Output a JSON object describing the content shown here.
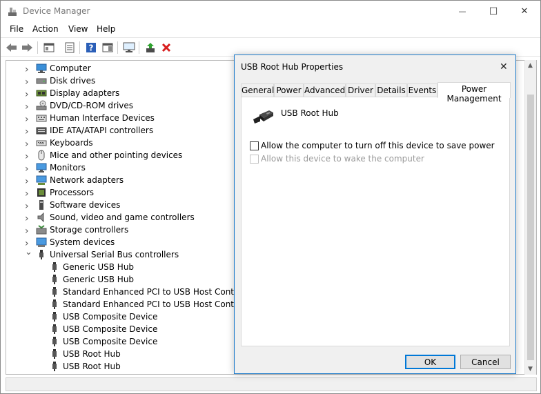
{
  "window": {
    "title": "Device Manager",
    "minimize_glyph": "—",
    "maximize_glyph": "☐",
    "close_glyph": "✕"
  },
  "menu": [
    {
      "label": "File"
    },
    {
      "label": "Action"
    },
    {
      "label": "View"
    },
    {
      "label": "Help"
    }
  ],
  "toolbar": {
    "buttons": [
      "back-icon",
      "forward-icon",
      "show-hide-tree-icon",
      "properties-icon",
      "help-icon",
      "action-pane-icon",
      "monitor-icon",
      "update-driver-icon",
      "uninstall-icon"
    ]
  },
  "tree": {
    "items": [
      {
        "label": "Computer",
        "icon": "computer-icon",
        "state": "collapsed"
      },
      {
        "label": "Disk drives",
        "icon": "disk-drive-icon",
        "state": "collapsed"
      },
      {
        "label": "Display adapters",
        "icon": "display-adapter-icon",
        "state": "collapsed"
      },
      {
        "label": "DVD/CD-ROM drives",
        "icon": "dvd-icon",
        "state": "collapsed"
      },
      {
        "label": "Human Interface Devices",
        "icon": "hid-icon",
        "state": "collapsed"
      },
      {
        "label": "IDE ATA/ATAPI controllers",
        "icon": "ide-icon",
        "state": "collapsed"
      },
      {
        "label": "Keyboards",
        "icon": "keyboard-icon",
        "state": "collapsed"
      },
      {
        "label": "Mice and other pointing devices",
        "icon": "mouse-icon",
        "state": "collapsed"
      },
      {
        "label": "Monitors",
        "icon": "monitor-icon",
        "state": "collapsed"
      },
      {
        "label": "Network adapters",
        "icon": "network-icon",
        "state": "collapsed"
      },
      {
        "label": "Processors",
        "icon": "processor-icon",
        "state": "collapsed"
      },
      {
        "label": "Software devices",
        "icon": "software-device-icon",
        "state": "collapsed"
      },
      {
        "label": "Sound, video and game controllers",
        "icon": "sound-icon",
        "state": "collapsed"
      },
      {
        "label": "Storage controllers",
        "icon": "storage-icon",
        "state": "collapsed"
      },
      {
        "label": "System devices",
        "icon": "system-device-icon",
        "state": "collapsed"
      },
      {
        "label": "Universal Serial Bus controllers",
        "icon": "usb-icon",
        "state": "expanded"
      }
    ],
    "usb_children": [
      {
        "label": "Generic USB Hub"
      },
      {
        "label": "Generic USB Hub"
      },
      {
        "label": "Standard Enhanced PCI to USB Host Controller"
      },
      {
        "label": "Standard Enhanced PCI to USB Host Controller"
      },
      {
        "label": "USB Composite Device"
      },
      {
        "label": "USB Composite Device"
      },
      {
        "label": "USB Composite Device"
      },
      {
        "label": "USB Root Hub"
      },
      {
        "label": "USB Root Hub"
      }
    ]
  },
  "dialog": {
    "title": "USB Root Hub Properties",
    "close_glyph": "✕",
    "tabs": [
      {
        "label": "General"
      },
      {
        "label": "Power"
      },
      {
        "label": "Advanced"
      },
      {
        "label": "Driver"
      },
      {
        "label": "Details"
      },
      {
        "label": "Events"
      },
      {
        "label": "Power Management",
        "active": true
      }
    ],
    "device_name": "USB Root Hub",
    "options": [
      {
        "label": "Allow the computer to turn off this device to save power",
        "checked": false,
        "enabled": true
      },
      {
        "label": "Allow this device to wake the computer",
        "checked": false,
        "enabled": false
      }
    ],
    "ok_label": "OK",
    "cancel_label": "Cancel"
  },
  "colors": {
    "accent": "#0078d7",
    "dialog_border": "#1979ca",
    "uninstall_red": "#d81e1e"
  }
}
